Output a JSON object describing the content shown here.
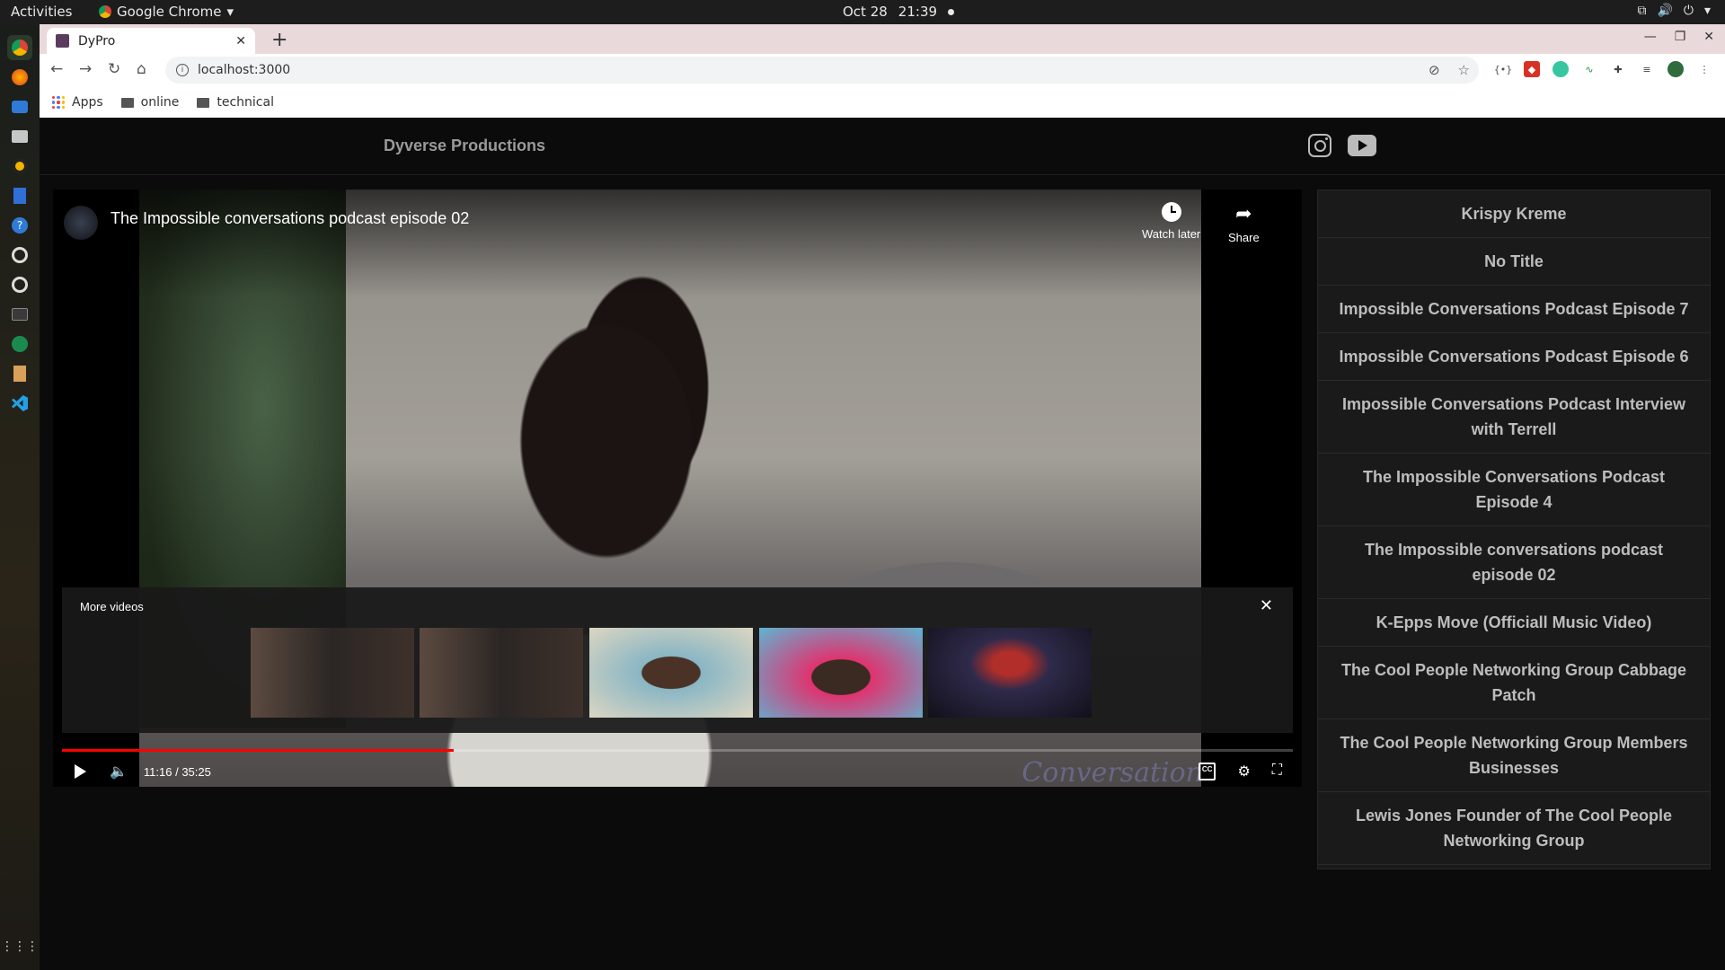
{
  "system": {
    "activities": "Activities",
    "app_menu": "Google Chrome",
    "date": "Oct 28",
    "time": "21:39"
  },
  "browser": {
    "tab_title": "DyPro",
    "url": "localhost:3000",
    "bookmarks": [
      "Apps",
      "online",
      "technical"
    ]
  },
  "site": {
    "brand": "Dyverse Productions"
  },
  "player": {
    "title": "The Impossible conversations podcast episode 02",
    "watch_later": "Watch later",
    "share": "Share",
    "more_videos": "More videos",
    "time_display": "11:16 / 35:25",
    "progress": 0.318,
    "watermark": "Conversation"
  },
  "playlist": [
    "Krispy Kreme",
    "No Title",
    "Impossible Conversations Podcast Episode 7",
    "Impossible Conversations Podcast Episode 6",
    "Impossible Conversations Podcast Interview with Terrell",
    "The Impossible Conversations Podcast Episode 4",
    "The Impossible conversations podcast episode 02",
    "K-Epps Move (Officiall Music Video)",
    "The Cool People Networking Group Cabbage Patch",
    "The Cool People Networking Group Members Businesses",
    "Lewis Jones Founder of The Cool People Networking Group"
  ],
  "colors": {
    "progress_played": "#ff0000",
    "page_bg": "#0b0b0b",
    "sidebar_bg": "#1a1a1a"
  }
}
